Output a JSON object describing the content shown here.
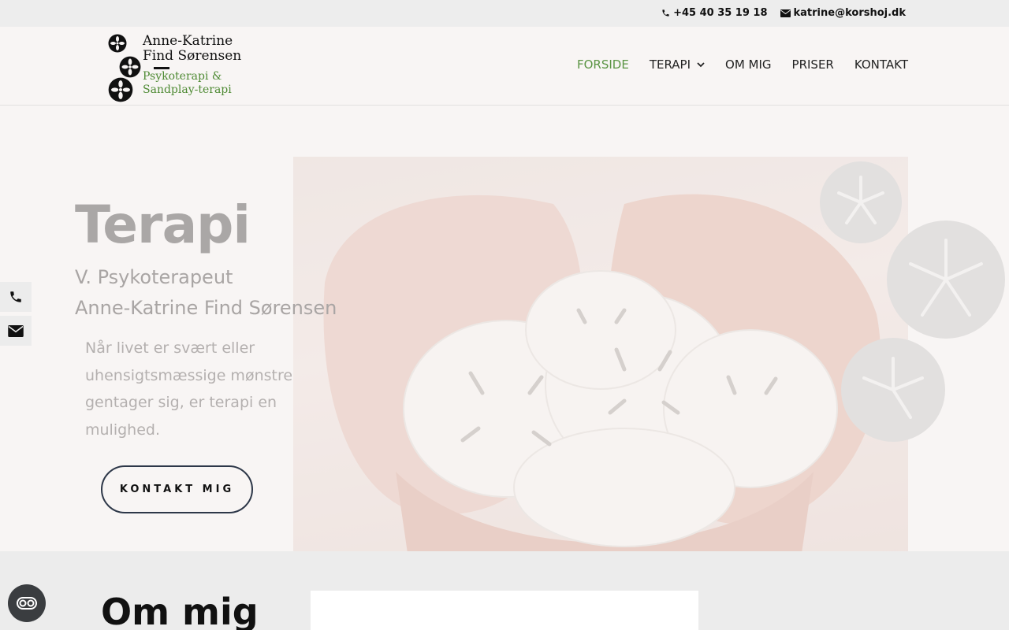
{
  "topbar": {
    "phone": "+45 40 35 19 18",
    "email": "katrine@korshoj.dk"
  },
  "logo": {
    "line1": "Anne-Katrine",
    "line2": "Find Sørensen",
    "line3": "Psykoterapi &",
    "line4": "Sandplay-terapi"
  },
  "nav": {
    "items": [
      {
        "label": "FORSIDE",
        "active": true
      },
      {
        "label": "TERAPI",
        "dropdown": true
      },
      {
        "label": "OM MIG"
      },
      {
        "label": "PRISER"
      },
      {
        "label": "KONTAKT"
      }
    ]
  },
  "hero": {
    "title": "Terapi",
    "subtitle_line1": "V. Psykoterapeut",
    "subtitle_line2": "Anne-Katrine Find Sørensen",
    "text": "Når livet er svært eller uhensigtsmæssige mønstre gentager sig, er terapi en mulighed.",
    "cta": "KONTAKT MIG"
  },
  "section2": {
    "title": "Om mig"
  },
  "colors": {
    "accent_green": "#5a9443",
    "background": "#f8f5f4",
    "button_border": "#2d3748"
  },
  "icons": {
    "phone": "phone-icon",
    "email": "envelope-icon",
    "cookie": "cookie-settings-icon"
  }
}
